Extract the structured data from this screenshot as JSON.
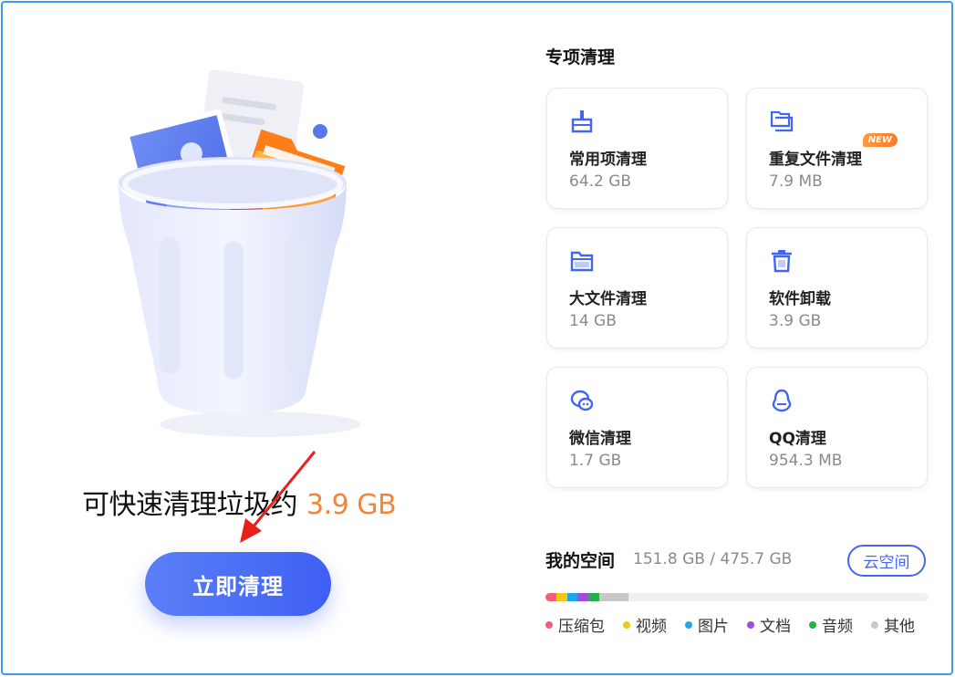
{
  "headline": {
    "text": "可快速清理垃圾约",
    "size": "3.9 GB"
  },
  "clean_button": {
    "label": "立即清理"
  },
  "special": {
    "title": "专项清理",
    "cards": [
      {
        "title": "常用项清理",
        "value": "64.2 GB",
        "icon": "broom-icon"
      },
      {
        "title": "重复文件清理",
        "value": "7.9 MB",
        "icon": "duplicate-folder-icon",
        "badge": "NEW"
      },
      {
        "title": "大文件清理",
        "value": "14 GB",
        "icon": "folder-icon"
      },
      {
        "title": "软件卸载",
        "value": "3.9 GB",
        "icon": "trash-icon"
      },
      {
        "title": "微信清理",
        "value": "1.7 GB",
        "icon": "wechat-icon"
      },
      {
        "title": "QQ清理",
        "value": "954.3 MB",
        "icon": "qq-icon"
      }
    ]
  },
  "space": {
    "title": "我的空间",
    "value": "151.8 GB / 475.7 GB",
    "cloud_button": "云空间",
    "segments": [
      {
        "name": "压缩包",
        "color": "#f0607a",
        "fraction": 0.028
      },
      {
        "name": "视频",
        "color": "#f5c518",
        "fraction": 0.028
      },
      {
        "name": "图片",
        "color": "#1ea7e8",
        "fraction": 0.028
      },
      {
        "name": "文档",
        "color": "#a04ed8",
        "fraction": 0.028
      },
      {
        "name": "音频",
        "color": "#26b04a",
        "fraction": 0.028
      },
      {
        "name": "其他",
        "color": "#c8c8c8",
        "fraction": 0.076
      }
    ]
  },
  "colors": {
    "accent": "#4266f1",
    "highlight": "#f5843a"
  }
}
